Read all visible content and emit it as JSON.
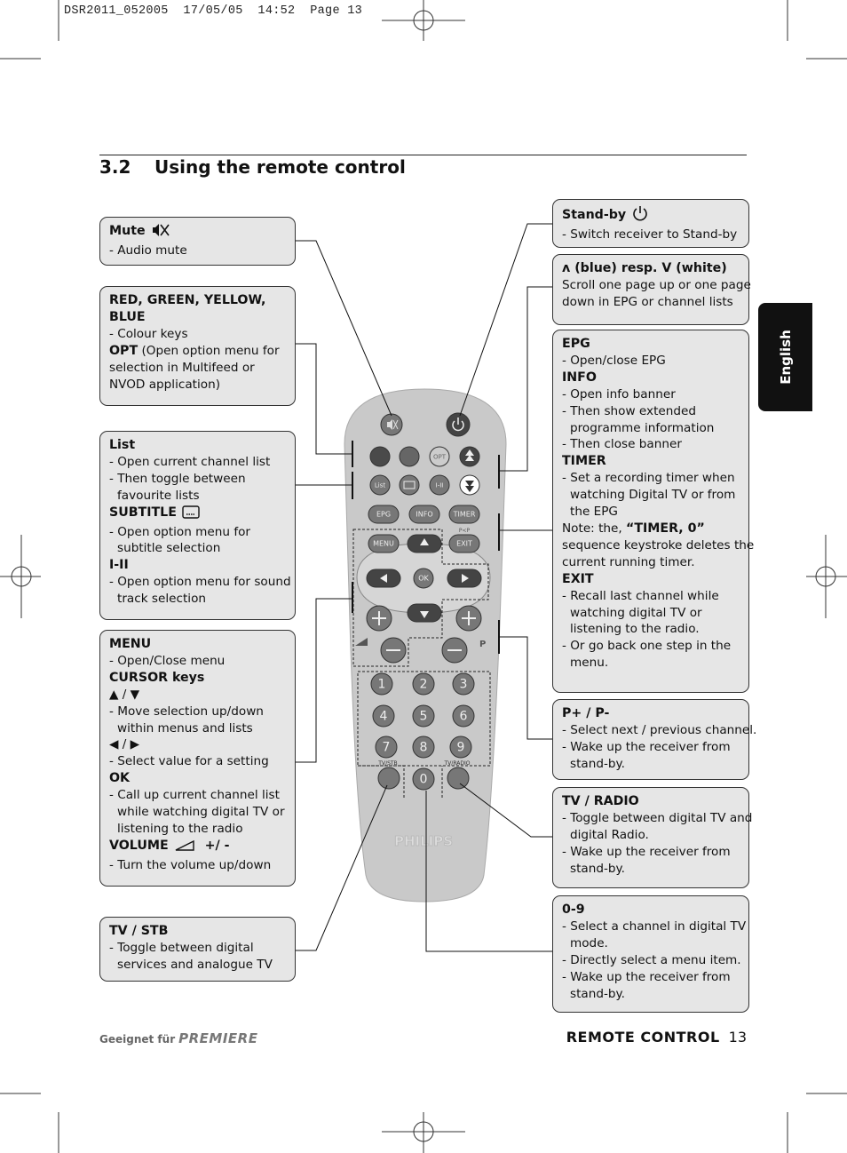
{
  "slug": "DSR2011_052005  17/05/05  14:52  Page 13",
  "section": {
    "number": "3.2",
    "title": "Using the remote control"
  },
  "language_tab": "English",
  "footer": {
    "left_text": "Geeignet für",
    "logo": "PREMIERE",
    "right_label": "REMOTE CONTROL",
    "page_number": "13"
  },
  "remote": {
    "brand": "PHILIPS",
    "buttons": [
      "OPT",
      "List",
      "I-II",
      "EPG",
      "INFO",
      "TIMER",
      "MENU",
      "EXIT",
      "OK",
      "1",
      "2",
      "3",
      "4",
      "5",
      "6",
      "7",
      "8",
      "9",
      "0"
    ],
    "labels": {
      "pip": "P<P",
      "prog": "P",
      "tvstb": "TV/STB",
      "tvradio": "TV/RADIO"
    }
  },
  "boxes": [
    {
      "id": "mute",
      "lines": [
        {
          "b": "Mute",
          "icon": "mute-icon"
        },
        {
          "t": "- Audio mute"
        }
      ]
    },
    {
      "id": "colour",
      "lines": [
        {
          "b": "RED, GREEN, YELLOW,"
        },
        {
          "b": "BLUE"
        },
        {
          "t": "- Colour keys"
        },
        {
          "b": "OPT",
          "t": " (Open option menu for"
        },
        {
          "t": "selection in Multifeed or"
        },
        {
          "t": "NVOD application)"
        }
      ]
    },
    {
      "id": "list",
      "lines": [
        {
          "b": "List"
        },
        {
          "t": "- Open current channel list"
        },
        {
          "t": "- Then toggle between"
        },
        {
          "t": "favourite lists",
          "i": 1
        },
        {
          "b": "SUBTITLE",
          "icon": "subtitle-icon"
        },
        {
          "t": "- Open option menu for"
        },
        {
          "t": "subtitle selection",
          "i": 1
        },
        {
          "b": "I-II"
        },
        {
          "t": "- Open option menu for sound"
        },
        {
          "t": "track selection",
          "i": 1
        }
      ]
    },
    {
      "id": "menu",
      "lines": [
        {
          "b": "MENU"
        },
        {
          "t": "- Open/Close menu"
        },
        {
          "b": "CURSOR keys"
        },
        {
          "t": "▲ / ▼"
        },
        {
          "t": "- Move selection up/down"
        },
        {
          "t": "within menus and lists",
          "i": 1
        },
        {
          "t": "◀  /  ▶"
        },
        {
          "t": "- Select value for a setting"
        },
        {
          "b": "OK"
        },
        {
          "t": "- Call up current channel list"
        },
        {
          "t": "while watching digital TV or",
          "i": 1
        },
        {
          "t": "listening to the radio",
          "i": 1
        },
        {
          "b": "VOLUME",
          "icon": "volume-icon",
          "t2": "+/ -"
        },
        {
          "t": "- Turn the volume up/down"
        }
      ]
    },
    {
      "id": "tvstb",
      "lines": [
        {
          "b": "TV / STB"
        },
        {
          "t": "- Toggle between digital"
        },
        {
          "t": "services and analogue TV",
          "i": 1
        }
      ]
    },
    {
      "id": "standby",
      "lines": [
        {
          "b": "Stand-by",
          "icon": "power-icon"
        },
        {
          "t": "- Switch receiver to Stand-by"
        }
      ]
    },
    {
      "id": "scroll",
      "lines": [
        {
          "b": " ʌ  (blue) resp. V (white)"
        },
        {
          "t": "Scroll one page up or one page"
        },
        {
          "t": "down in EPG or channel lists"
        }
      ]
    },
    {
      "id": "epg",
      "lines": [
        {
          "b": "EPG"
        },
        {
          "t": "- Open/close EPG"
        },
        {
          "b": "INFO"
        },
        {
          "t": "- Open info banner"
        },
        {
          "t": "- Then show extended"
        },
        {
          "t": "programme information",
          "i": 1
        },
        {
          "t": "- Then close banner"
        },
        {
          "b": "TIMER"
        },
        {
          "t": "- Set a recording timer when"
        },
        {
          "t": "watching Digital TV or from",
          "i": 1
        },
        {
          "t": "the EPG",
          "i": 1
        },
        {
          "t": "Note: the, ",
          "b2": "“TIMER, 0”"
        },
        {
          "t": "sequence keystroke deletes the"
        },
        {
          "t": "current running timer."
        },
        {
          "b": "EXIT"
        },
        {
          "t": "- Recall last channel while"
        },
        {
          "t": "watching digital TV or",
          "i": 1
        },
        {
          "t": "listening to the radio.",
          "i": 1
        },
        {
          "t": "- Or go back one step in the"
        },
        {
          "t": "menu.",
          "i": 1
        }
      ]
    },
    {
      "id": "pp",
      "lines": [
        {
          "b": "P+ / P-"
        },
        {
          "t": "- Select next / previous channel."
        },
        {
          "t": "- Wake up the receiver from"
        },
        {
          "t": "stand-by.",
          "i": 1
        }
      ]
    },
    {
      "id": "tvradio",
      "lines": [
        {
          "b": "TV / RADIO"
        },
        {
          "t": "- Toggle between digital TV and"
        },
        {
          "t": "digital Radio.",
          "i": 1
        },
        {
          "t": "- Wake up the receiver from"
        },
        {
          "t": "stand-by.",
          "i": 1
        }
      ]
    },
    {
      "id": "digits",
      "lines": [
        {
          "b": "0-9"
        },
        {
          "t": "- Select a channel in digital TV"
        },
        {
          "t": "mode.",
          "i": 1
        },
        {
          "t": "- Directly select a menu item."
        },
        {
          "t": "- Wake up the receiver from"
        },
        {
          "t": "stand-by.",
          "i": 1
        }
      ]
    }
  ],
  "colors": {
    "box_bg": "#e6e6e6",
    "remote_body": "#c8c8c8",
    "button_dark": "#555555",
    "tab_bg": "#111111"
  }
}
